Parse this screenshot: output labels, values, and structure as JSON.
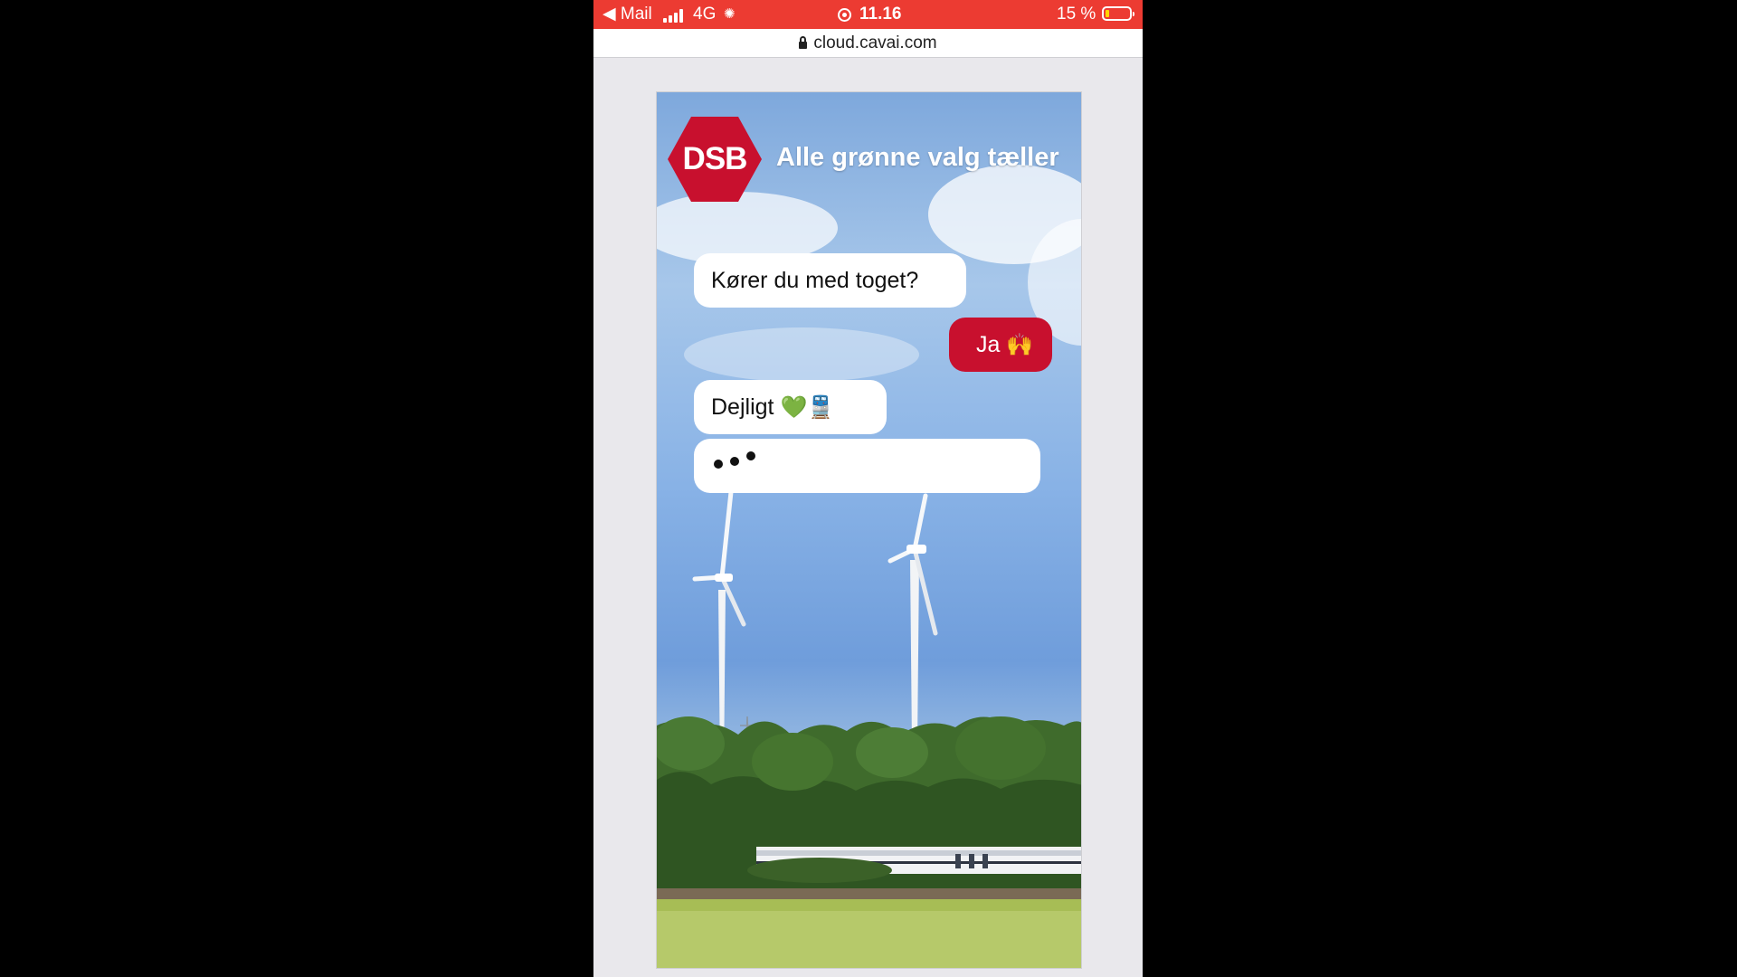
{
  "status_bar": {
    "back_app": "◀ Mail",
    "network": "4G",
    "time": "11.16",
    "battery": "15 %"
  },
  "browser": {
    "url": "cloud.cavai.com"
  },
  "ad": {
    "brand": "DSB",
    "tagline": "Alle grønne valg tæller",
    "chat": {
      "bot_question": "Kører du med toget?",
      "user_reply": "Ja",
      "user_reply_emoji": "🙌",
      "bot_response": "Dejligt",
      "bot_response_emoji": "💚🚆"
    },
    "colors": {
      "brand_red": "#c8102e",
      "status_bar_red": "#ec3b32"
    }
  }
}
